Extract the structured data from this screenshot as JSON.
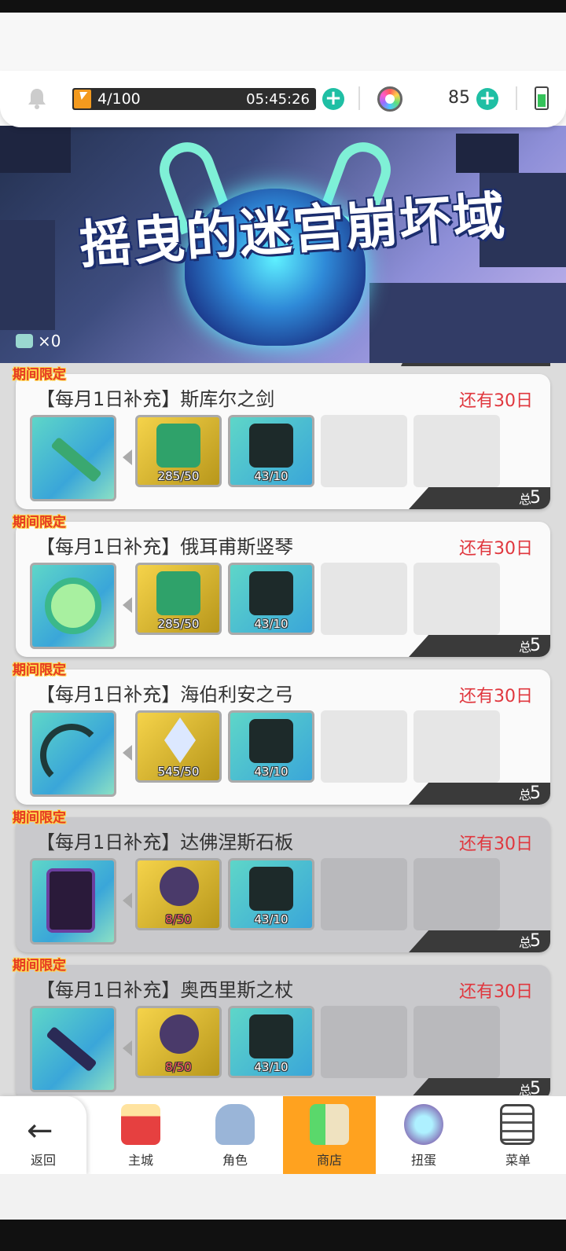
{
  "topbar": {
    "energy_value": "4/100",
    "energy_timer": "05:45:26",
    "gem_count": "85"
  },
  "banner": {
    "title": "摇曳的迷宫崩坏域",
    "token_count": "×0"
  },
  "cards": [
    {
      "tag": "期间限定",
      "name": "【每月1日补充】斯库尔之剑",
      "remaining": "还有30日",
      "mat1": "285/50",
      "mat2": "43/10",
      "stock_label": "总库存数",
      "stock": "5"
    },
    {
      "tag": "期间限定",
      "name": "【每月1日补充】俄耳甫斯竖琴",
      "remaining": "还有30日",
      "mat1": "285/50",
      "mat2": "43/10",
      "stock_label": "总库存数",
      "stock": "5"
    },
    {
      "tag": "期间限定",
      "name": "【每月1日补充】海伯利安之弓",
      "remaining": "还有30日",
      "mat1": "545/50",
      "mat2": "43/10",
      "stock_label": "总库存数",
      "stock": "5"
    },
    {
      "tag": "期间限定",
      "name": "【每月1日补充】达佛涅斯石板",
      "remaining": "还有30日",
      "mat1": "8/50",
      "mat2": "43/10",
      "stock_label": "总库存数",
      "stock": "5"
    },
    {
      "tag": "期间限定",
      "name": "【每月1日补充】奥西里斯之杖",
      "remaining": "还有30日",
      "mat1": "8/50",
      "mat2": "43/10",
      "stock_label": "总库存数",
      "stock": "5"
    }
  ],
  "navbar": {
    "back": "返回",
    "main_city": "主城",
    "character": "角色",
    "shop": "商店",
    "gacha": "扭蛋",
    "menu": "菜单"
  },
  "colors": {
    "accent": "#1fbfa4",
    "active_tab": "#ffa21f",
    "remaining_text": "#e0373e",
    "tag_text": "#e53a23"
  }
}
